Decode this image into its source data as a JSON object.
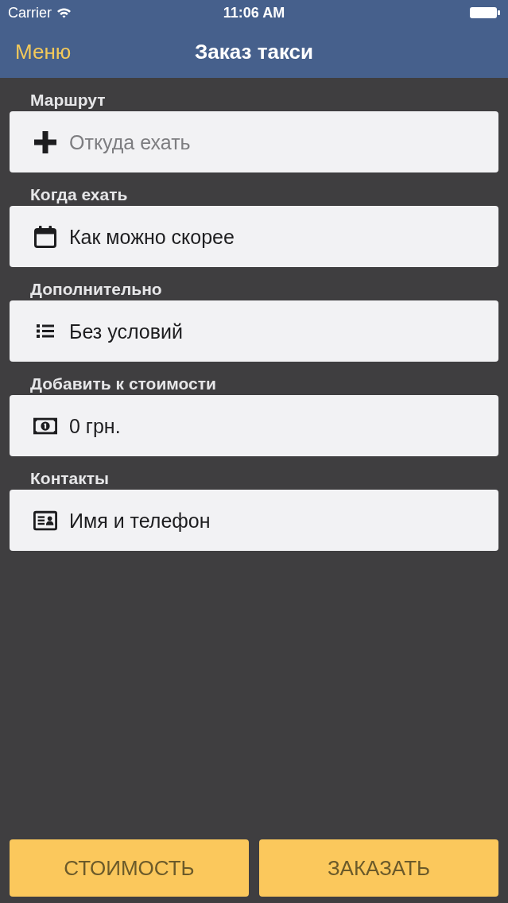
{
  "status_bar": {
    "carrier": "Carrier",
    "time": "11:06 AM"
  },
  "nav_bar": {
    "back": "Меню",
    "title": "Заказ такси"
  },
  "sections": [
    {
      "label": "Маршрут",
      "placeholder": "Откуда ехать"
    },
    {
      "label": "Когда ехать",
      "value": "Как можно скорее"
    },
    {
      "label": "Дополнительно",
      "value": "Без условий"
    },
    {
      "label": "Добавить к стоимости",
      "value": "0 грн."
    },
    {
      "label": "Контакты",
      "value": "Имя и телефон"
    }
  ],
  "buttons": [
    "СТОИМОСТЬ",
    "ЗАКАЗАТЬ"
  ]
}
